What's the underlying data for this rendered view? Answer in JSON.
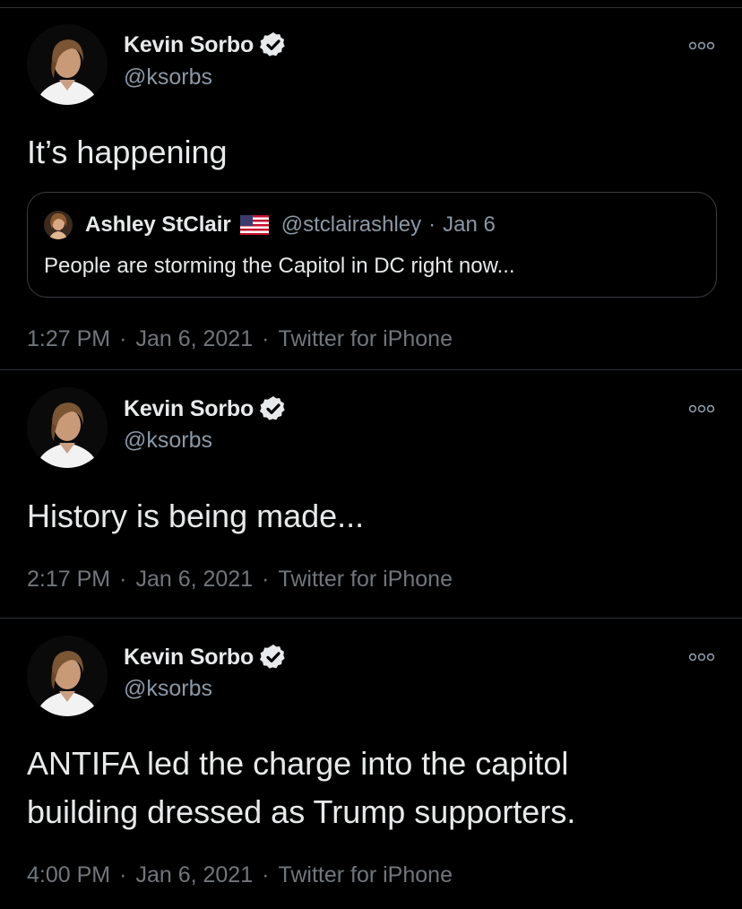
{
  "tweets": [
    {
      "author_name": "Kevin Sorbo",
      "author_handle": "@ksorbs",
      "text": "It’s happening",
      "quote": {
        "author_name": "Ashley StClair",
        "author_handle": "@stclairashley",
        "separator": "·",
        "date": "Jan 6",
        "text": "People are storming the Capitol in DC right now..."
      },
      "time": "1:27 PM",
      "date": "Jan 6, 2021",
      "source": "Twitter for iPhone"
    },
    {
      "author_name": "Kevin Sorbo",
      "author_handle": "@ksorbs",
      "text": "History is being made...",
      "time": "2:17 PM",
      "date": "Jan 6, 2021",
      "source": "Twitter for iPhone"
    },
    {
      "author_name": "Kevin Sorbo",
      "author_handle": "@ksorbs",
      "text_line1": "ANTIFA led the charge into the capitol",
      "text_line2": "building dressed as Trump supporters.",
      "time": "4:00 PM",
      "date": "Jan 6, 2021",
      "source": "Twitter for iPhone"
    }
  ],
  "meta_separator": "·",
  "icons": {
    "verified": "verified-badge-icon",
    "more": "more-options-icon",
    "flag": "us-flag-icon"
  },
  "colors": {
    "background": "#000000",
    "text": "#e7e9ea",
    "secondary": "#8b98a5",
    "verified": "#e7e9ea",
    "divider": "#2f3336"
  }
}
